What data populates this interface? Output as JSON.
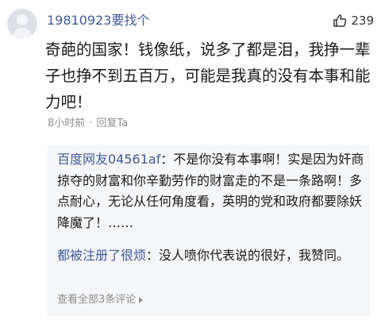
{
  "comment": {
    "username": "19810923要找个",
    "likes": "239",
    "text": "奇葩的国家！钱像纸，说多了都是泪，我挣一辈子也挣不到五百万，可能是我真的没有本事和能力吧！",
    "time": "8小时前",
    "separator": "·",
    "reply_action": "回复Ta"
  },
  "replies": [
    {
      "name": "百度网友04561af",
      "text": "：不是你没有本事啊！实是因为奸商掠夺的财富和你辛勤劳作的财富走的不是一条路啊！多点耐心，无论从任何角度看，英明的党和政府都要除妖降魔了！……"
    },
    {
      "name": "都被注册了很烦",
      "text": "：没人喷你代表说的很好，我赞同。"
    }
  ],
  "view_all": "查看全部3条评论",
  "icons": {
    "avatar": "default-user-avatar",
    "like": "thumbs-up-icon",
    "view_all": "triangle-right-icon"
  },
  "colors": {
    "username": "#40599a",
    "reply_box_bg": "#f5f6f8",
    "meta": "#8c8c8c"
  }
}
